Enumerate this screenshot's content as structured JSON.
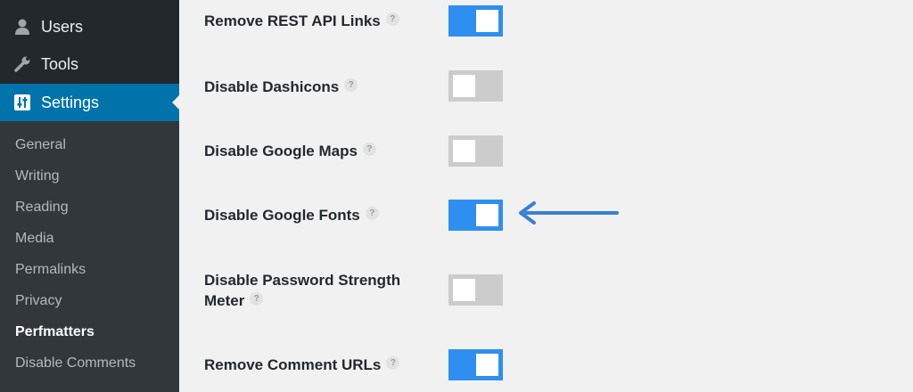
{
  "sidebar": {
    "menu": [
      {
        "label": "Users",
        "icon": "user-icon"
      },
      {
        "label": "Tools",
        "icon": "wrench-icon"
      },
      {
        "label": "Settings",
        "icon": "settings-icon",
        "active": true
      }
    ],
    "submenu": [
      {
        "label": "General"
      },
      {
        "label": "Writing"
      },
      {
        "label": "Reading"
      },
      {
        "label": "Media"
      },
      {
        "label": "Permalinks"
      },
      {
        "label": "Privacy"
      },
      {
        "label": "Perfmatters",
        "current": true
      },
      {
        "label": "Disable Comments"
      }
    ]
  },
  "settings": [
    {
      "label": "Remove REST API Links",
      "help": "?",
      "enabled": true
    },
    {
      "label": "Disable Dashicons",
      "help": "?",
      "enabled": false
    },
    {
      "label": "Disable Google Maps",
      "help": "?",
      "enabled": false
    },
    {
      "label": "Disable Google Fonts",
      "help": "?",
      "enabled": true
    },
    {
      "label_line1": "Disable Password Strength",
      "label_line2": "Meter",
      "help": "?",
      "enabled": false
    },
    {
      "label": "Remove Comment URLs",
      "help": "?",
      "enabled": true
    }
  ],
  "colors": {
    "sidebar_bg": "#23282d",
    "submenu_bg": "#32373c",
    "active_menu": "#0073aa",
    "toggle_on": "#2e8ff0",
    "toggle_off": "#cccccc",
    "arrow": "#3a7fd5"
  }
}
